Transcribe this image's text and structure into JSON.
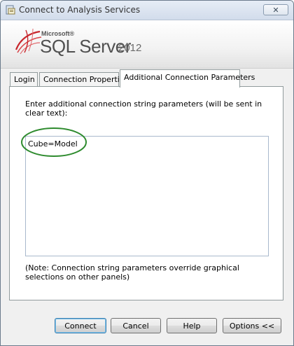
{
  "window": {
    "title": "Connect to Analysis Services",
    "close_label": "✕"
  },
  "banner": {
    "brand": "Microsoft®",
    "product": "SQL Server",
    "version": "2012"
  },
  "tabs": [
    {
      "label": "Login"
    },
    {
      "label": "Connection Properties"
    },
    {
      "label": "Additional Connection Parameters",
      "selected": true
    }
  ],
  "panel": {
    "instructions": "Enter additional connection string parameters (will be sent in clear text):",
    "params_value": "Cube=Model",
    "note": "(Note: Connection string parameters override graphical selections on other panels)"
  },
  "buttons": {
    "connect": "Connect",
    "cancel": "Cancel",
    "help": "Help",
    "options": "Options <<"
  },
  "colors": {
    "highlight_ellipse": "#2e8b2e",
    "logo_red": "#c8272d"
  },
  "icons": [
    "app-icon",
    "close-icon",
    "sql-server-logo-icon"
  ]
}
